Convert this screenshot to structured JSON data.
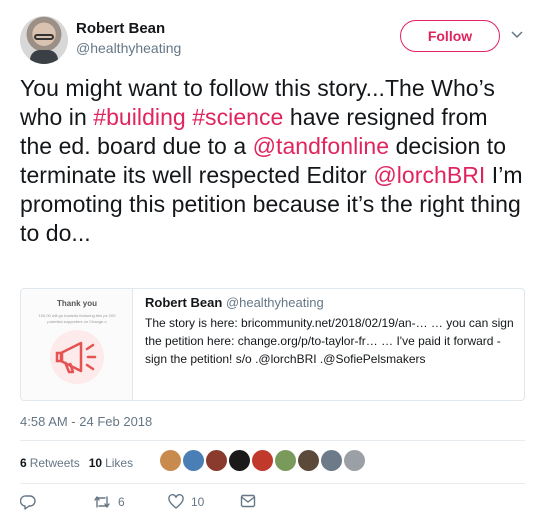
{
  "user": {
    "name": "Robert Bean",
    "handle": "@healthyheating",
    "follow_label": "Follow"
  },
  "tweet": {
    "parts": [
      {
        "text": "You might want to follow this story...The Who’s who in ",
        "link": false
      },
      {
        "text": "#building",
        "link": true
      },
      {
        "text": " ",
        "link": false
      },
      {
        "text": "#science",
        "link": true
      },
      {
        "text": " have resigned from the ed. board due to a ",
        "link": false
      },
      {
        "text": "@tandfonline",
        "link": true
      },
      {
        "text": " decision to terminate its well respected Editor ",
        "link": false
      },
      {
        "text": "@lorchBRI",
        "link": true
      },
      {
        "text": " I’m promoting this petition because it’s the right thing to do...",
        "link": false
      }
    ]
  },
  "card": {
    "image_title": "Thank you",
    "image_text": "100,00 will go towards featuring this pe 200 potential supporters on Change.o",
    "author_name": "Robert Bean",
    "author_handle": "@healthyheating",
    "description": "The story is here: bricommunity.net/2018/02/19/an-… …  you can sign the petition here: change.org/p/to-taylor-fr… …  I've paid it forward - sign the petition! s/o .@lorchBRI .@SofiePelsmakers"
  },
  "timestamp": "4:58 AM - 24 Feb 2018",
  "stats": {
    "retweets_count": "6",
    "retweets_label": "Retweets",
    "likes_count": "10",
    "likes_label": "Likes"
  },
  "liker_avatars": [
    {
      "color": "#c98a4e"
    },
    {
      "color": "#4a7fb5"
    },
    {
      "color": "#8a3b2e"
    },
    {
      "color": "#1a1a1a"
    },
    {
      "color": "#c0392b"
    },
    {
      "color": "#7a9a5c"
    },
    {
      "color": "#5b4a3a"
    },
    {
      "color": "#6d7a8a"
    },
    {
      "color": "#9aa0a6"
    }
  ],
  "actions": {
    "retweet_count": "6",
    "like_count": "10"
  },
  "colors": {
    "accent": "#e0245e",
    "secondary_text": "#657786",
    "border": "#e1e8ed"
  }
}
